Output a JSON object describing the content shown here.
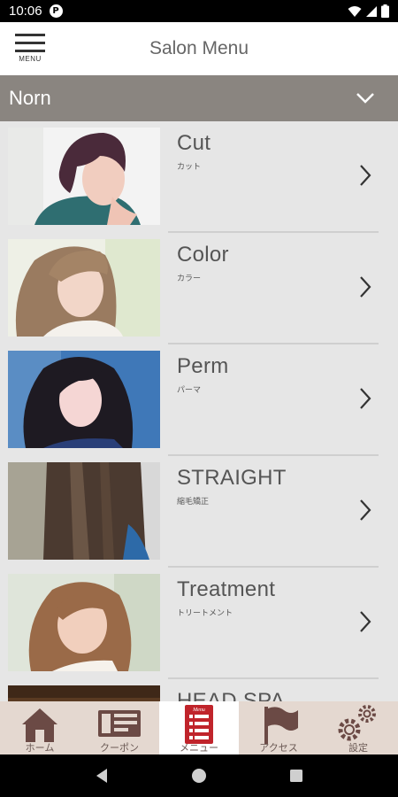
{
  "status_bar": {
    "time": "10:06",
    "app_icon_letter": "P"
  },
  "header": {
    "menu_label": "MENU",
    "title": "Salon Menu"
  },
  "salon_selector": {
    "name": "Norn"
  },
  "menu_items": [
    {
      "title": "Cut",
      "subtitle": "カット"
    },
    {
      "title": "Color",
      "subtitle": "カラー"
    },
    {
      "title": "Perm",
      "subtitle": "パーマ"
    },
    {
      "title": "STRAIGHT",
      "subtitle": "縮毛矯正"
    },
    {
      "title": "Treatment",
      "subtitle": "トリートメント"
    },
    {
      "title": "HEAD SPA",
      "subtitle": ""
    }
  ],
  "tabs": [
    {
      "label": "ホーム",
      "icon": "home-icon"
    },
    {
      "label": "クーポン",
      "icon": "coupon-icon"
    },
    {
      "label": "メニュー",
      "icon": "menu-book-icon",
      "badge": "Menu",
      "active": true
    },
    {
      "label": "アクセス",
      "icon": "flag-icon"
    },
    {
      "label": "設定",
      "icon": "settings-gears-icon"
    }
  ],
  "colors": {
    "selector_bg": "#8a8580",
    "tab_bar_bg": "#e4d8d0",
    "tab_icon": "#6b4a45",
    "menu_tab_red": "#c0242b"
  }
}
